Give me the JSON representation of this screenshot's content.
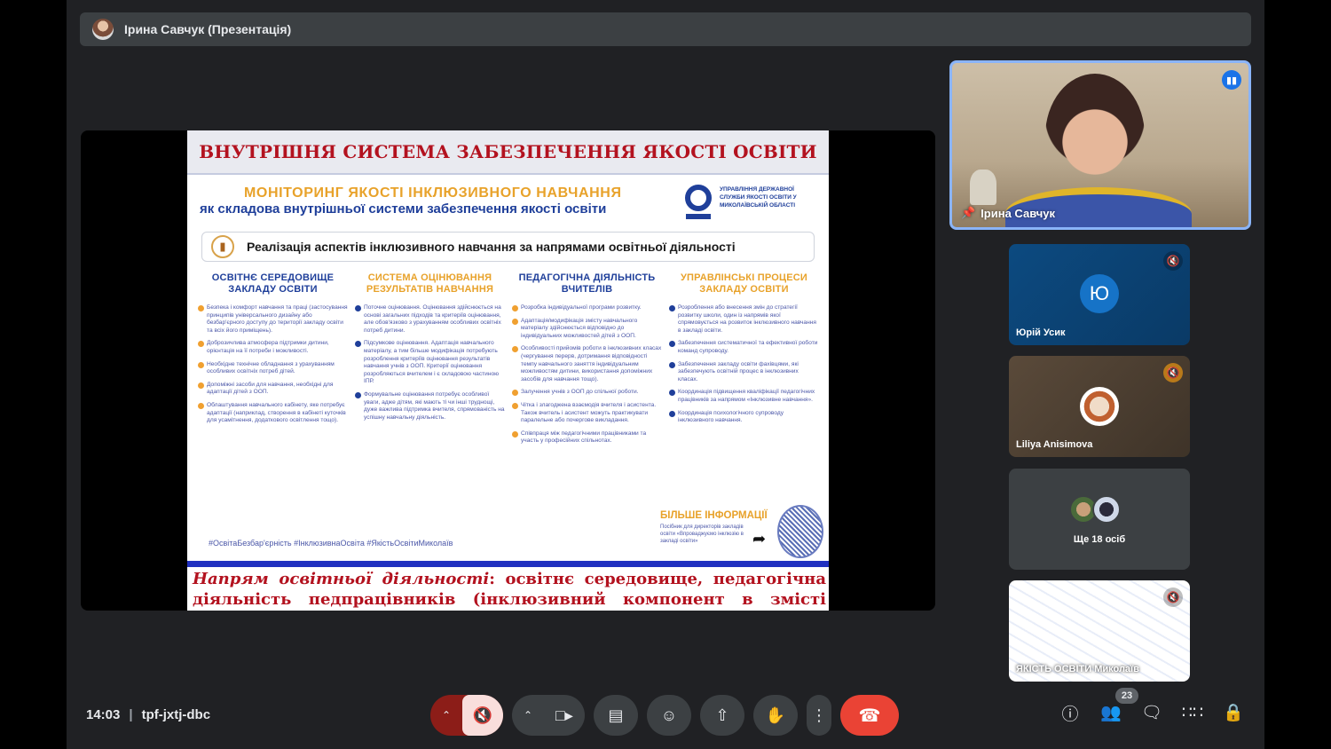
{
  "presenter": {
    "name": "Ірина Савчук (Презентація)"
  },
  "slide": {
    "title": "ВНУТРІШНЯ СИСТЕМА ЗАБЕЗПЕЧЕННЯ ЯКОСТІ ОСВІТИ",
    "monitoring_title": "МОНІТОРИНГ ЯКОСТІ ІНКЛЮЗИВНОГО НАВЧАННЯ",
    "monitoring_subtitle": "як складова внутрішньої системи забезпечення якості освіти",
    "org_name": "УПРАВЛІННЯ ДЕРЖАВНОЇ СЛУЖБИ ЯКОСТІ ОСВІТИ У МИКОЛАЇВСЬКІЙ ОБЛАСТІ",
    "aspect_heading": "Реалізація аспектів інклюзивного навчання за напрямами освітньої діяльності",
    "columns": [
      {
        "heading": "ОСВІТНЄ СЕРЕДОВИЩЕ ЗАКЛАДУ ОСВІТИ",
        "color": "blue",
        "items": [
          "Безпека і комфорт навчання та праці (застосування принципів універсального дизайну або безбар'єрного доступу до території закладу освіти та всіх його приміщень).",
          "Доброзичлива атмосфера підтримки дитини, орієнтація на її потреби і можливості.",
          "Необхідне технічне обладнання з урахуванням особливих освітніх потреб дітей.",
          "Допоміжні засоби для навчання, необхідні для адаптації дітей з ООП.",
          "Облаштування навчального кабінету, яке потребує адаптації (наприклад, створення в кабінеті куточків для усамітнення, додаткового освітлення тощо)."
        ]
      },
      {
        "heading": "СИСТЕМА ОЦІНЮВАННЯ РЕЗУЛЬТАТІВ НАВЧАННЯ",
        "color": "orange",
        "items": [
          "Поточне оцінювання. Оцінювання здійснюється на основі загальних підходів та критеріїв оцінювання, але обов'язково з урахуванням особливих освітніх потреб дитини.",
          "Підсумкове оцінювання. Адаптація навчального матеріалу, а тим більше модифікація потребують розроблення критеріїв оцінювання результатів навчання учнів з ООП. Критерії оцінювання розробляються вчителем і є складовою частиною ІПР.",
          "Формувальне оцінювання потребує особливої уваги, адже дітям, які мають ті чи інші труднощі, дуже важлива підтримка вчителя, спрямованість на успішну навчальну діяльність."
        ]
      },
      {
        "heading": "ПЕДАГОГІЧНА ДІЯЛЬНІСТЬ ВЧИТЕЛІВ",
        "color": "blue",
        "items": [
          "Розробка індивідуальної програми розвитку.",
          "Адаптація/модифікація змісту навчального матеріалу здійснюється відповідно до індивідуальних можливостей дітей з ООП.",
          "Особливості прийомів роботи в інклюзивних класах (чергування перерв, дотримання відповідності темпу навчального заняття індивідуальним можливостям дитини, використання допоміжних засобів для навчання тощо).",
          "Залучення учнів з ООП до спільної роботи.",
          "Чітка і злагоджена взаємодія вчителя і асистента. Також вчитель і асистент можуть практикувати паралельне або почергове викладання.",
          "Співпраця між педагогічними працівниками та участь у професійних спільнотах."
        ]
      },
      {
        "heading": "УПРАВЛІНСЬКІ ПРОЦЕСИ ЗАКЛАДУ ОСВІТИ",
        "color": "orange",
        "items": [
          "Розроблення або внесення змін до стратегії розвитку школи, один із напрямів якої спрямовується на розвиток інклюзивного навчання в закладі освіти.",
          "Забезпечення систематичної та ефективної роботи команд супроводу.",
          "Забезпечення закладу освіти фахівцями, які забезпечують освітній процес в інклюзивних класах.",
          "Координація підвищення кваліфікації педагогічних працівників за напрямом «Інклюзивне навчання».",
          "Координація психологічного супроводу інклюзивного навчання."
        ]
      }
    ],
    "hashtags": "#ОсвітаБезбар'єрність #ІнклюзивнаОсвіта #ЯкістьОсвітиМиколаїв",
    "more_info_title": "БІЛЬШЕ ІНФОРМАЦІЇ",
    "more_info_text": "Посібник для директорів закладів освіти «Впроваджуємо інклюзію в закладі освіти»",
    "caption_label": "Напрям освітньої діяльності",
    "caption_text": ": освітнє середовище, педагогічна діяльність педпрацівників (інклюзивний компонент в змісті освіти)"
  },
  "participants": {
    "main": {
      "name": "Ірина Савчук"
    },
    "tiles": [
      {
        "name": "Юрій Усик",
        "initial": "Ю"
      },
      {
        "name": "Liliya Anisimova"
      },
      {
        "name": "Ще 18 осіб"
      },
      {
        "name": "ЯКІСТЬ ОСВІТИ Миколаїв"
      }
    ]
  },
  "meeting": {
    "time": "14:03",
    "code": "tpf-jxtj-dbc",
    "participant_count": "23"
  },
  "colors": {
    "end_call": "#ea4335",
    "muted_mic_bg": "#f9dedc",
    "active_speaker_border": "#8ab4f8"
  }
}
